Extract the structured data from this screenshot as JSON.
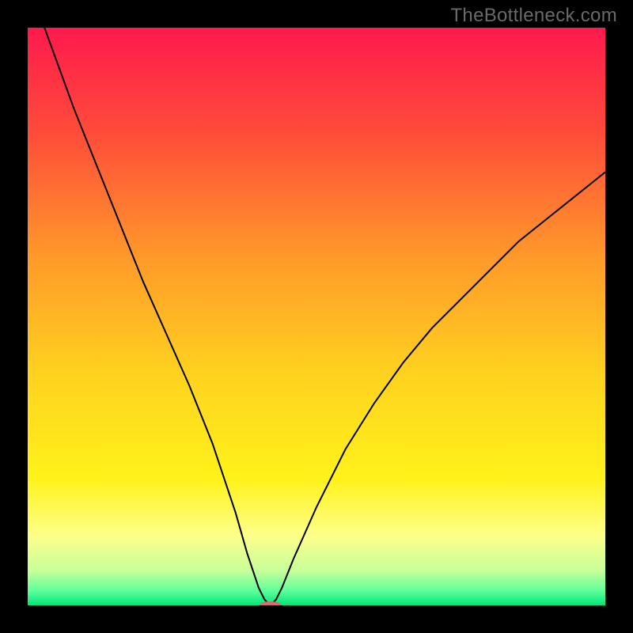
{
  "watermark": "TheBottleneck.com",
  "chart_data": {
    "type": "line",
    "title": "",
    "xlabel": "",
    "ylabel": "",
    "xlim": [
      0,
      100
    ],
    "ylim": [
      0,
      100
    ],
    "grid": false,
    "legend": false,
    "background_gradient": {
      "stops": [
        {
          "offset": 0.0,
          "color": "#ff1a4d"
        },
        {
          "offset": 0.18,
          "color": "#ff4b3a"
        },
        {
          "offset": 0.4,
          "color": "#ff9a2a"
        },
        {
          "offset": 0.6,
          "color": "#ffd21f"
        },
        {
          "offset": 0.78,
          "color": "#fff21a"
        },
        {
          "offset": 0.88,
          "color": "#fdff8a"
        },
        {
          "offset": 0.94,
          "color": "#c8ff9a"
        },
        {
          "offset": 0.975,
          "color": "#5dff9a"
        },
        {
          "offset": 1.0,
          "color": "#00e57a"
        }
      ]
    },
    "series": [
      {
        "name": "bottleneck-curve",
        "color": "#000000",
        "stroke_width": 2,
        "x": [
          0,
          4,
          8,
          12,
          16,
          20,
          24,
          28,
          32,
          36,
          38,
          40,
          41,
          42,
          43,
          44,
          46,
          50,
          55,
          60,
          65,
          70,
          75,
          80,
          85,
          90,
          95,
          100
        ],
        "y": [
          108,
          97,
          86,
          76,
          66,
          56,
          47,
          38,
          28,
          16,
          9,
          3,
          1,
          0,
          1,
          3,
          8,
          17,
          27,
          35,
          42,
          48,
          53,
          58,
          63,
          67,
          71,
          75
        ]
      }
    ],
    "marker": {
      "name": "optimal-point",
      "x": 42,
      "y": 0,
      "color": "#d07070",
      "rx": 14,
      "ry": 5
    }
  }
}
